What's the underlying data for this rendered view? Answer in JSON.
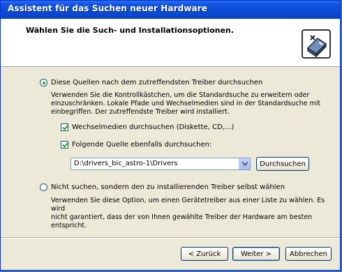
{
  "window": {
    "title": "Assistent für das Suchen neuer Hardware"
  },
  "header": {
    "title": "Wählen Sie die Such- und Installationsoptionen.",
    "icon": "hardware-wizard-icon"
  },
  "option_search": {
    "label": "Diese Quellen nach dem zutreffendsten Treiber durchsuchen",
    "checked": true,
    "description_lines": [
      "Verwenden Sie die Kontrollkästchen, um die Standardsuche zu erweitern oder",
      "einzuschränken. Lokale Pfade und Wechselmedien sind in der Standardsuche mit",
      "einbegriffen. Der zutreffendste Treiber wird installiert."
    ],
    "checkbox_removable": {
      "label": "Wechselmedien durchsuchen (Diskette, CD,...)",
      "checked": true
    },
    "checkbox_location": {
      "label": "Folgende Quelle ebenfalls durchsuchen:",
      "checked": true
    },
    "path_value": "D:\\drivers_bic_astro-1\\Drivers",
    "browse_label": "Durchsuchen"
  },
  "option_manual": {
    "label": "Nicht suchen, sondern den zu installierenden Treiber selbst wählen",
    "checked": false,
    "description_lines": [
      "Verwenden Sie diese Option, um einen Gerätetreiber aus einer Liste zu wählen. Es wird",
      "nicht garantiert, dass der von Ihnen gewählte Treiber der Hardware am besten entspricht."
    ]
  },
  "footer": {
    "back_label": "< Zurück",
    "next_label": "Weiter >",
    "cancel_label": "Abbrechen"
  },
  "colors": {
    "titlebar": "#0a4bd6",
    "window_bg": "#ece9d8",
    "check_green": "#21a121"
  }
}
